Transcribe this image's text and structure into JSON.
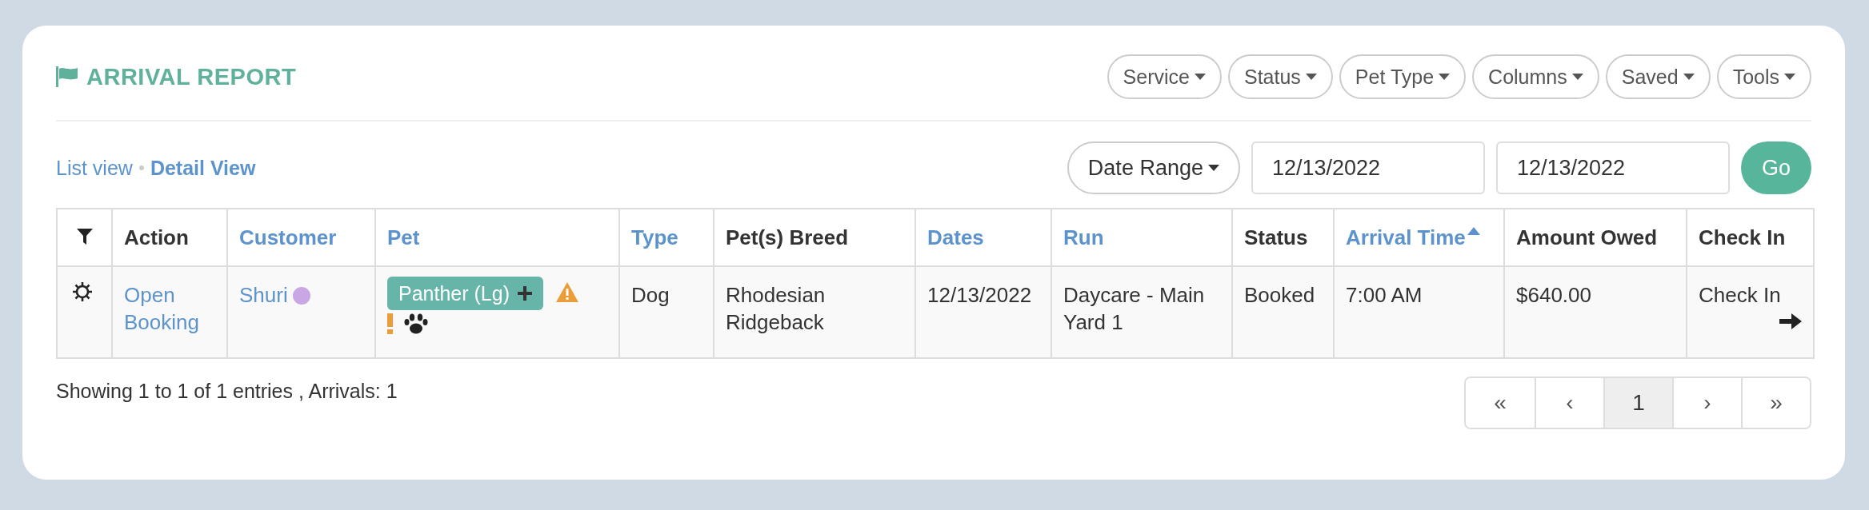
{
  "title": "ARRIVAL REPORT",
  "filter_buttons": [
    "Service",
    "Status",
    "Pet Type",
    "Columns",
    "Saved",
    "Tools"
  ],
  "views": [
    {
      "label": "List view",
      "selected": false
    },
    {
      "label": "Detail View",
      "selected": true
    }
  ],
  "date_filter": {
    "range_button": "Date Range",
    "start": "12/13/2022",
    "end": "12/13/2022",
    "go_button": "Go"
  },
  "table": {
    "columns": [
      {
        "kind": "filter"
      },
      {
        "kind": "text",
        "label": "Action",
        "sortable": false,
        "sorted": false
      },
      {
        "kind": "text",
        "label": "Customer",
        "sortable": true,
        "sorted": false
      },
      {
        "kind": "text",
        "label": "Pet",
        "sortable": true,
        "sorted": false
      },
      {
        "kind": "text",
        "label": "Type",
        "sortable": true,
        "sorted": false
      },
      {
        "kind": "text",
        "label": "Pet(s) Breed",
        "sortable": false,
        "sorted": false
      },
      {
        "kind": "text",
        "label": "Dates",
        "sortable": true,
        "sorted": false
      },
      {
        "kind": "text",
        "label": "Run",
        "sortable": true,
        "sorted": false
      },
      {
        "kind": "text",
        "label": "Status",
        "sortable": false,
        "sorted": false
      },
      {
        "kind": "text",
        "label": "Arrival Time",
        "sortable": true,
        "sorted": true
      },
      {
        "kind": "text",
        "label": "Amount Owed",
        "sortable": false,
        "sorted": false
      },
      {
        "kind": "text",
        "label": "Check In",
        "sortable": false,
        "sorted": false
      }
    ],
    "rows": [
      {
        "action": "Open Booking",
        "customer": "Shuri",
        "color": "#c9a6e4",
        "pet": "Panther (Lg)",
        "pet_warning": true,
        "pet_alert": true,
        "type": "Dog",
        "breed": "Rhodesian Ridgeback",
        "dates": "12/13/2022",
        "run": "Daycare - Main Yard 1",
        "status": "Booked",
        "arrival_time": "7:00 AM",
        "amount_owed": "$640.00",
        "check_in": "Check In"
      }
    ]
  },
  "summary": "Showing 1 to 1 of 1 entries , Arrivals: 1",
  "pagination": [
    {
      "label": "«",
      "selected": false
    },
    {
      "label": "‹",
      "selected": false
    },
    {
      "label": "1",
      "selected": true
    },
    {
      "label": "›",
      "selected": false
    },
    {
      "label": "»",
      "selected": false
    }
  ]
}
